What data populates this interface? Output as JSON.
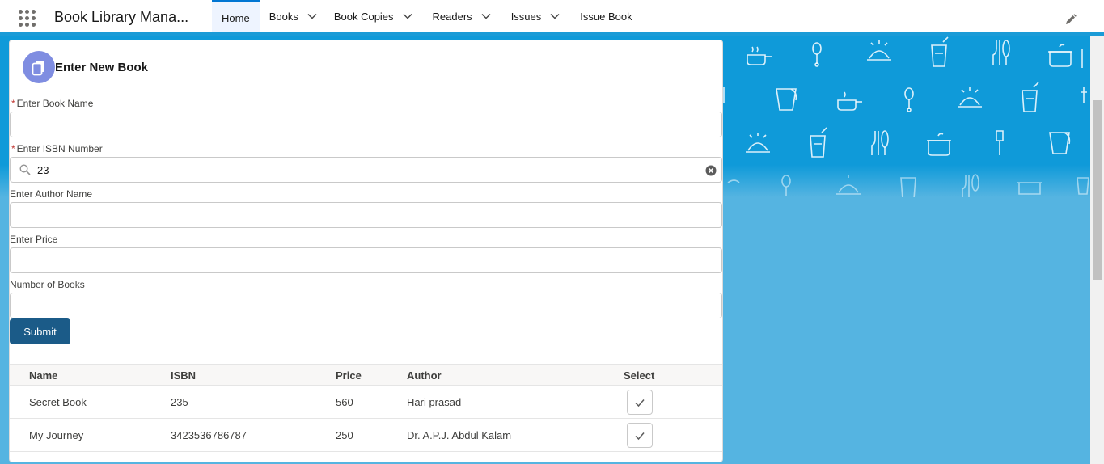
{
  "app": {
    "name": "Book Library Mana..."
  },
  "nav": {
    "tabs": [
      {
        "label": "Home",
        "active": true,
        "has_menu": false
      },
      {
        "label": "Books",
        "active": false,
        "has_menu": true
      },
      {
        "label": "Book Copies",
        "active": false,
        "has_menu": true
      },
      {
        "label": "Readers",
        "active": false,
        "has_menu": true
      },
      {
        "label": "Issues",
        "active": false,
        "has_menu": true
      },
      {
        "label": "Issue Book",
        "active": false,
        "has_menu": false
      }
    ]
  },
  "form": {
    "title": "Enter New Book",
    "required_marker": "*",
    "book_name": {
      "label": "Enter Book Name",
      "value": "",
      "required": true
    },
    "isbn": {
      "label": "Enter ISBN Number",
      "value": "23",
      "required": true
    },
    "author": {
      "label": "Enter Author Name",
      "value": ""
    },
    "price": {
      "label": "Enter Price",
      "value": ""
    },
    "count": {
      "label": "Number of Books",
      "value": ""
    },
    "submit_label": "Submit"
  },
  "table": {
    "headers": [
      "Name",
      "ISBN",
      "Price",
      "Author",
      "Select"
    ],
    "rows": [
      [
        "Secret Book",
        "235",
        "560",
        "Hari prasad"
      ],
      [
        "My Journey",
        "3423536786787",
        "250",
        "Dr. A.P.J. Abdul Kalam"
      ]
    ]
  },
  "colors": {
    "brand_blue": "#0176d3",
    "background_blue": "#55b4e1",
    "submit_button": "#1b5b88",
    "card_icon": "#7f8de1"
  },
  "icons": {
    "app_launcher": "app-launcher-icon",
    "edit": "pencil-icon",
    "card": "copy-icon",
    "search": "search-icon",
    "clear": "clear-icon",
    "select": "check-icon"
  }
}
